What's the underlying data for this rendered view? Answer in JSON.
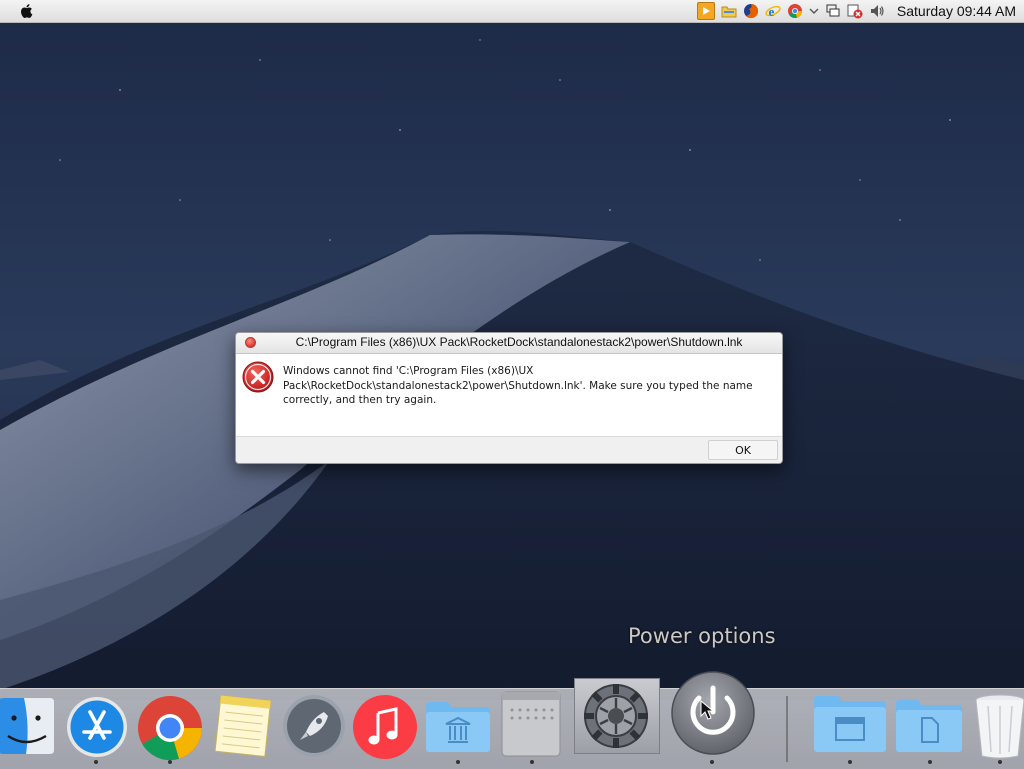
{
  "menubar": {
    "apple_icon": "apple-icon",
    "tray_icons": [
      "media-player-icon",
      "folder-icon",
      "firefox-icon",
      "internet-explorer-icon",
      "chrome-icon",
      "chevron-down-icon",
      "network-icon",
      "security-alert-icon",
      "volume-icon"
    ],
    "clock": "Saturday 09:44 AM"
  },
  "dialog": {
    "title": "C:\\Program Files (x86)\\UX Pack\\RocketDock\\standalonestack2\\power\\Shutdown.lnk",
    "message_line1": "Windows cannot find 'C:\\Program Files (x86)\\UX",
    "message_line2": "Pack\\RocketDock\\standalonestack2\\power\\Shutdown.lnk'. Make sure you typed the name",
    "message_line3": "correctly, and then try again.",
    "ok_label": "OK",
    "icon": "error-icon"
  },
  "dock": {
    "hover_label": "Power options",
    "items": [
      "finder-icon",
      "app-store-icon",
      "chrome-icon",
      "notes-icon",
      "launchpad-icon",
      "music-icon",
      "applications-folder-icon",
      "mac-pro-icon",
      "system-preferences-icon",
      "power-icon",
      "documents-folder-icon",
      "files-folder-icon",
      "trash-icon"
    ]
  },
  "colors": {
    "accent_error": "#d32f2f",
    "dialog_bg": "#ffffff",
    "menubar_bg": "#e8e8e8"
  }
}
